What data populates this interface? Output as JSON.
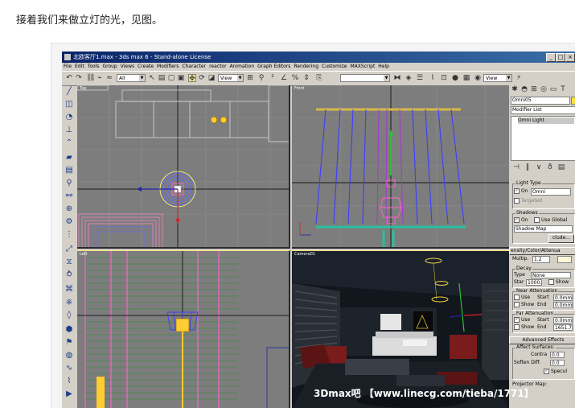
{
  "caption": "接着我们来做立灯的光，见图。",
  "window": {
    "title": "北欧客厅1.max - 3ds max 6 - Stand-alone License",
    "minimize": "_",
    "maximize": "□",
    "close": "×"
  },
  "menu": [
    "File",
    "Edit",
    "Tools",
    "Group",
    "Views",
    "Create",
    "Modifiers",
    "Character",
    "reactor",
    "Animation",
    "Graph Editors",
    "Rendering",
    "Customize",
    "MAXScript",
    "Help"
  ],
  "toolbar": {
    "selection_filter": "All",
    "ref_coord": "View",
    "named_selection": "",
    "render_view": "View"
  },
  "viewports": {
    "top": "Top",
    "front": "Front",
    "left": "Left",
    "camera": "Camera01"
  },
  "panel": {
    "object_name": "Omni05",
    "modifier_list": "Modifier List",
    "stack_item": "Omni Light",
    "light_type": {
      "title": "Light Type",
      "on_label": "On",
      "type_value": "Omni",
      "targeted_label": "Targeted"
    },
    "shadows": {
      "title": "Shadows",
      "on_label": "On",
      "use_global_label": "Use Global",
      "shadow_type": "Shadow Map",
      "exclude_button": "clude..."
    },
    "intensity": {
      "title": "ensity/Color/Attenua",
      "multiplier_label": "Multip.",
      "multiplier_value": "1.2",
      "decay_title": "Decay",
      "decay_type_label": "Type",
      "decay_type_value": "None",
      "decay_start_label": "Star",
      "decay_start_value": "1000.",
      "decay_show_label": "Show",
      "near_title": "Near Attenuation",
      "near_use_label": "Use",
      "near_start_label": "Start",
      "near_start_value": "0.0mm",
      "near_show_label": "Show",
      "near_end_label": "End",
      "near_end_value": "0.0mm",
      "far_title": "Far Attenuation",
      "far_use_label": "Use",
      "far_start_label": "Start",
      "far_start_value": "0.0mm",
      "far_show_label": "Show",
      "far_end_label": "End",
      "far_end_value": "1651.7"
    },
    "advanced": {
      "rollout_title": "Advanced Effects",
      "affect_title": "Affect Surfaces:",
      "contrast_label": "Contra",
      "contrast_value": "0.0",
      "soften_label": "Soften Diff.",
      "soften_value": "0.0",
      "specular_label": "Specul",
      "projector_label": "Projector Map:"
    }
  },
  "watermark": "3Dmax吧 【www.linecg.com/tieba/1771】",
  "colors": {
    "title_bar": "#0a246a",
    "viewport_gray": "#7d7d7d",
    "grid_line": "#8e8e8e",
    "lamp_blue": "#3c3cff",
    "lamp_yellow": "#ffcc33",
    "active_border": "#f0e080"
  }
}
